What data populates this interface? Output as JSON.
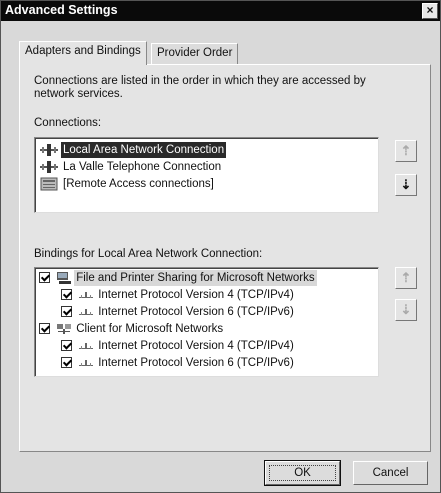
{
  "window": {
    "title": "Advanced Settings",
    "close_glyph": "×"
  },
  "tabs": [
    {
      "label": "Adapters and Bindings",
      "active": true
    },
    {
      "label": "Provider Order",
      "active": false
    }
  ],
  "description": "Connections are listed in the order in which they are accessed by network services.",
  "connections": {
    "label": "Connections:",
    "items": [
      {
        "label": "Local Area Network Connection",
        "icon": "network-adapter-icon",
        "selected": true
      },
      {
        "label": "La Valle Telephone Connection",
        "icon": "network-adapter-icon",
        "selected": false
      },
      {
        "label": "[Remote Access connections]",
        "icon": "remote-access-icon",
        "selected": false
      }
    ],
    "up_glyph": "⇡",
    "down_glyph": "⇣"
  },
  "bindings": {
    "label": "Bindings for Local Area Network Connection:",
    "items": [
      {
        "label": "File and Printer Sharing for Microsoft Networks",
        "level": 0,
        "checked": true,
        "icon": "file-printer-sharing-icon"
      },
      {
        "label": "Internet Protocol Version 4 (TCP/IPv4)",
        "level": 1,
        "checked": true,
        "icon": "protocol-icon"
      },
      {
        "label": "Internet Protocol Version 6 (TCP/IPv6)",
        "level": 1,
        "checked": true,
        "icon": "protocol-icon"
      },
      {
        "label": "Client for Microsoft Networks",
        "level": 0,
        "checked": true,
        "icon": "network-client-icon"
      },
      {
        "label": "Internet Protocol Version 4 (TCP/IPv4)",
        "level": 1,
        "checked": true,
        "icon": "protocol-icon"
      },
      {
        "label": "Internet Protocol Version 6 (TCP/IPv6)",
        "level": 1,
        "checked": true,
        "icon": "protocol-icon"
      }
    ],
    "up_glyph": "⇡",
    "down_glyph": "⇣"
  },
  "buttons": {
    "ok": "OK",
    "cancel": "Cancel"
  }
}
